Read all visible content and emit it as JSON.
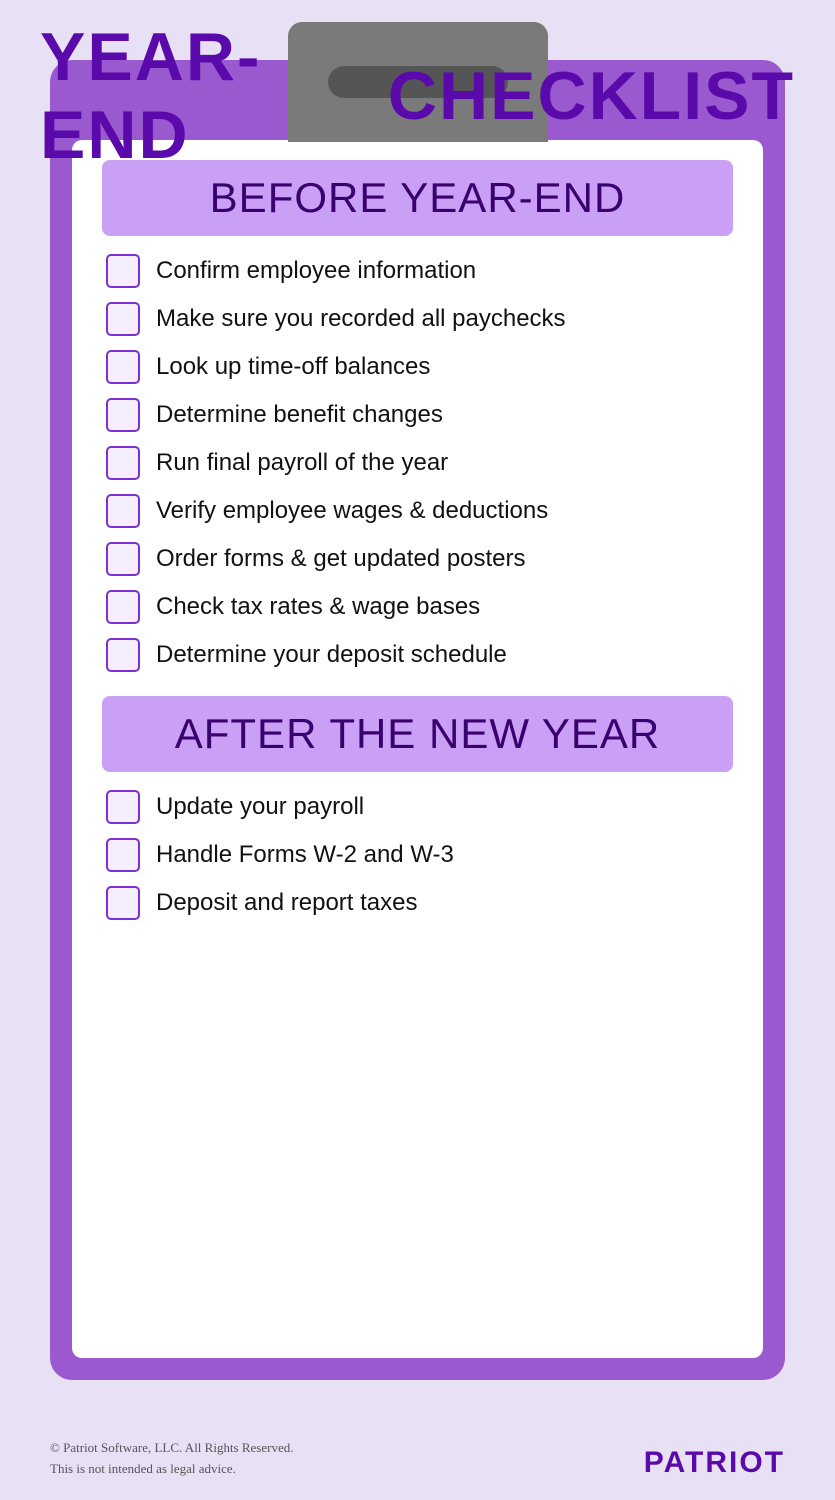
{
  "header": {
    "title_left": "YEAR-END",
    "title_right": "CHECKLIST"
  },
  "sections": {
    "before": {
      "label": "BEFORE YEAR-END",
      "items": [
        "Confirm employee information",
        "Make sure you recorded all paychecks",
        "Look up time-off balances",
        "Determine benefit changes",
        "Run final payroll of the year",
        "Verify employee wages & deductions",
        "Order forms & get updated posters",
        "Check tax rates & wage bases",
        "Determine your deposit schedule"
      ]
    },
    "after": {
      "label": "AFTER THE NEW YEAR",
      "items": [
        "Update your payroll",
        "Handle Forms W-2 and W-3",
        "Deposit and report taxes"
      ]
    }
  },
  "footer": {
    "copyright": "© Patriot Software, LLC. All Rights Reserved.",
    "disclaimer": "This is not intended as legal advice.",
    "logo": "PATRIOT"
  }
}
